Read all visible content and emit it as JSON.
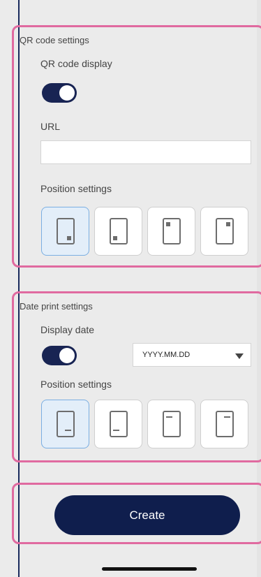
{
  "qr": {
    "title": "QR code settings",
    "display_label": "QR code display",
    "display_toggle_on": true,
    "url_label": "URL",
    "url_value": "",
    "position_label": "Position settings",
    "positions": [
      "bottom-right",
      "bottom-left",
      "top-left",
      "top-right"
    ],
    "selected_position": "bottom-right"
  },
  "date": {
    "title": "Date print settings",
    "display_label": "Display date",
    "display_toggle_on": true,
    "format_value": "YYYY.MM.DD",
    "position_label": "Position settings",
    "positions": [
      "bottom-right",
      "bottom-left",
      "top-left",
      "top-right"
    ],
    "selected_position": "bottom-right"
  },
  "actions": {
    "create_label": "Create"
  },
  "colors": {
    "accent": "#0f1e4d",
    "highlight_border": "#e06aa0",
    "selected_bg": "#e3eef9"
  },
  "icons": [
    "qr-position-icon",
    "date-position-icon",
    "dropdown-caret-icon"
  ]
}
